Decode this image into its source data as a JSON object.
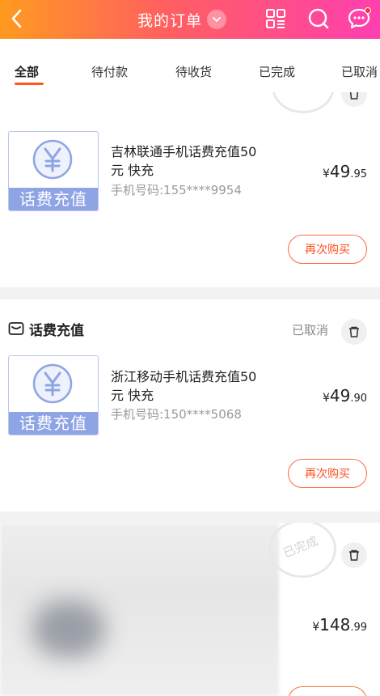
{
  "header": {
    "title": "我的订单",
    "icons": [
      "back-icon",
      "chevron-down-icon",
      "grid-icon",
      "search-icon",
      "message-icon"
    ],
    "gradient": [
      "#ff9a1f",
      "#ff5e62",
      "#ff3fb0"
    ]
  },
  "tabs": [
    {
      "label": "全部",
      "active": true
    },
    {
      "label": "待付款"
    },
    {
      "label": "待收货"
    },
    {
      "label": "已完成"
    },
    {
      "label": "已取消"
    }
  ],
  "orders": [
    {
      "thumb_label": "话费充值",
      "product_line1": "吉林联通手机话费充值50",
      "product_line2": "元 快充",
      "phone": "手机号码:155****9954",
      "price_currency": "¥",
      "price_int": "49",
      "price_dec": ".95",
      "rebuy_label": "再次购买"
    },
    {
      "shop_name": "话费充值",
      "status": "已取消",
      "thumb_label": "话费充值",
      "product_line1": "浙江移动手机话费充值50",
      "product_line2": "元 快充",
      "phone": "手机号码:150****5068",
      "price_currency": "¥",
      "price_int": "49",
      "price_dec": ".90",
      "rebuy_label": "再次购买"
    },
    {
      "stamp_text": "已完成",
      "price_currency": "¥",
      "price_int": "148",
      "price_dec": ".99"
    }
  ],
  "colors": {
    "accent": "#ff5a1f",
    "thumb_blue": "#8ea4e4"
  }
}
